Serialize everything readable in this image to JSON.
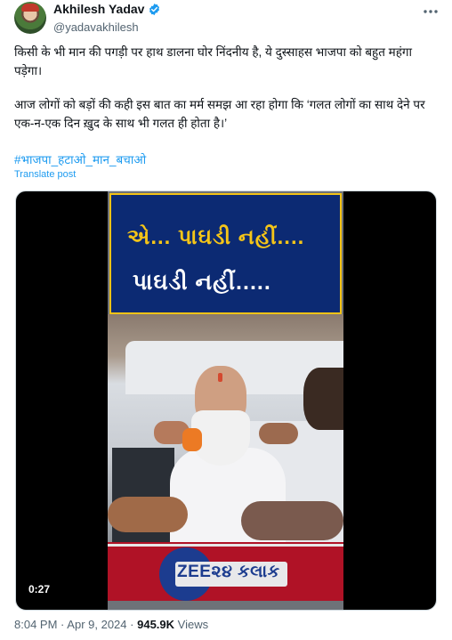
{
  "author": {
    "name": "Akhilesh Yadav",
    "handle": "@yadavakhilesh",
    "verified_badge": "verified-check-icon",
    "badge_color": "#1d9bf0"
  },
  "post": {
    "paragraph1": "किसी के भी मान की पगड़ी पर हाथ डालना घोर निंदनीय है, ये दुस्साहस भाजपा को बहुत महंगा पड़ेगा।",
    "paragraph2": "आज लोगों को बड़ों की कही इस बात का मर्म समझ आ रहा होगा कि ‘गलत लोगों का साथ देने पर एक-न-एक दिन ख़ुद के साथ भी गलत ही होता है।’",
    "hashtag": "#भाजपा_हटाओ_मान_बचाओ",
    "translate_label": "Translate post"
  },
  "video": {
    "overlay_line1": "એ... પાઘડી નહીં....",
    "overlay_line2": "પાઘડી નહીં.....",
    "channel_logo": "ZEE૨૪ કલાક",
    "duration": "0:27"
  },
  "meta": {
    "time": "8:04 PM",
    "separator": "·",
    "date": "Apr 9, 2024",
    "views_count": "945.9K",
    "views_label": "Views"
  }
}
